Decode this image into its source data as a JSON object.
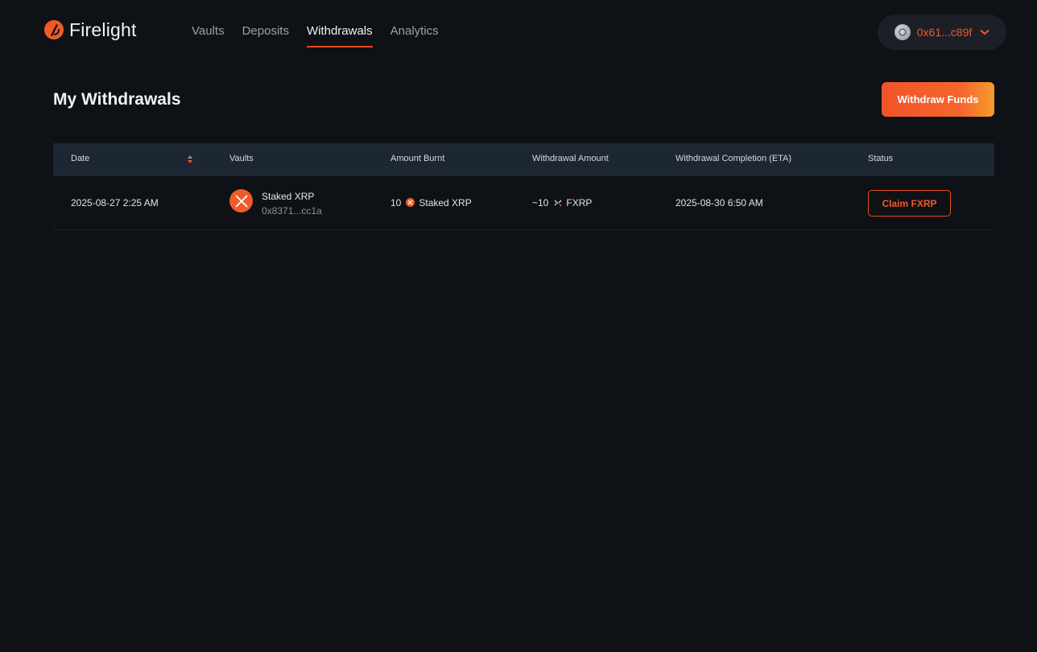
{
  "header": {
    "logo_text": "Firelight",
    "nav": [
      {
        "label": "Vaults"
      },
      {
        "label": "Deposits"
      },
      {
        "label": "Withdrawals"
      },
      {
        "label": "Analytics"
      }
    ],
    "active_nav": "Withdrawals",
    "wallet_address": "0x61...c89f"
  },
  "page": {
    "title": "My Withdrawals",
    "withdraw_button": "Withdraw Funds"
  },
  "table": {
    "columns": [
      "Date",
      "Vaults",
      "Amount Burnt",
      "Withdrawal Amount",
      "Withdrawal Completion (ETA)",
      "Status"
    ],
    "rows": [
      {
        "date": "2025-08-27 2:25 AM",
        "vault_name": "Staked XRP",
        "vault_address": "0x8371...cc1a",
        "amount_burnt_value": "10",
        "amount_burnt_token": "Staked XRP",
        "withdrawal_amount_value": "~10",
        "withdrawal_amount_token": "FXRP",
        "eta": "2025-08-30 6:50 AM",
        "status_action": "Claim FXRP"
      }
    ]
  },
  "colors": {
    "accent": "#f05a28",
    "background": "#0e1116",
    "table_header": "#1d2633"
  }
}
